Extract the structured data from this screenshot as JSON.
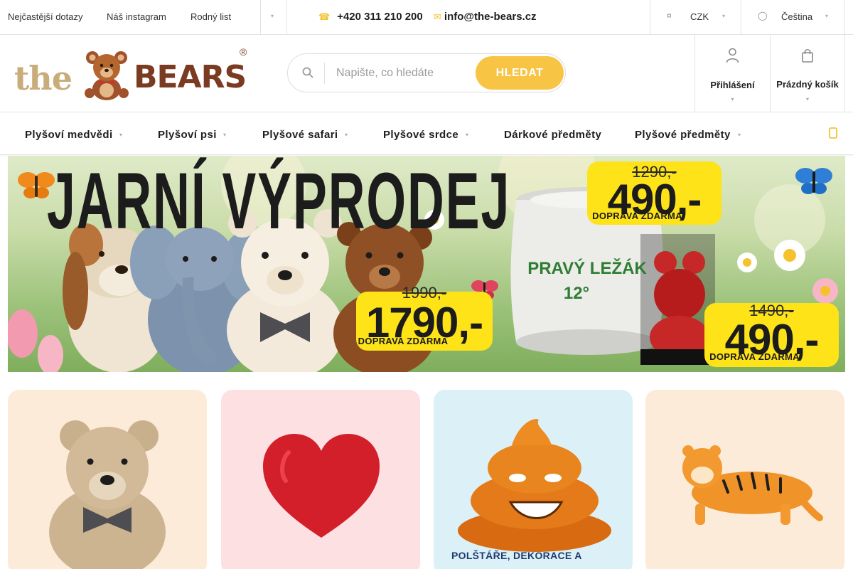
{
  "topbar": {
    "links": [
      "Nejčastější dotazy",
      "Náš instagram",
      "Rodný list"
    ],
    "phone": "+420 311 210 200",
    "email": "info@the-bears.cz",
    "currency": "CZK",
    "language": "Čeština"
  },
  "header": {
    "logo_the": "the",
    "logo_bears": "BEARS",
    "logo_reg": "®",
    "search_placeholder": "Napište, co hledáte",
    "search_button": "HLEDAT",
    "login_label": "Přihlášení",
    "cart_label": "Prázdný košík"
  },
  "nav": {
    "items": [
      "Plyšoví medvědi",
      "Plyšoví psi",
      "Plyšové safari",
      "Plyšové srdce",
      "Dárkové předměty",
      "Plyšové předměty"
    ]
  },
  "banner": {
    "title": "JARNÍ VÝPRODEJ",
    "keg_text_line1": "PRAVÝ LEŽÁK",
    "keg_text_line2": "12°",
    "offers": [
      {
        "old_price": "1990,-",
        "new_price": "1790,-",
        "shipping": "DOPRAVA ZDARMA"
      },
      {
        "old_price": "1290,-",
        "new_price": "490,-",
        "shipping": "DOPRAVA ZDARMA"
      },
      {
        "old_price": "1490,-",
        "new_price": "490,-",
        "shipping": "DOPRAVA ZDARMA"
      }
    ]
  },
  "categories": [
    {
      "label": "",
      "bg": "#fdebd9"
    },
    {
      "label": "",
      "bg": "#fde0e2"
    },
    {
      "label": "POLŠTÁŘE, DEKORACE A",
      "bg": "#dcf1f7"
    },
    {
      "label": "",
      "bg": "#fdebd9"
    }
  ],
  "colors": {
    "accent": "#f7c443",
    "price_tag": "#fde318",
    "logo_brown": "#7a3b20",
    "logo_tan": "#c8ad7a"
  }
}
